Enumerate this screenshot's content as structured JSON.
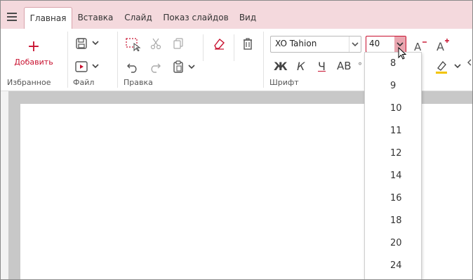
{
  "tabs": [
    "Главная",
    "Вставка",
    "Слайд",
    "Показ слайдов",
    "Вид"
  ],
  "ribbon": {
    "add_label": "Добавить",
    "groups": {
      "favorites": "Избранное",
      "file": "Файл",
      "edit": "Правка",
      "font": "Шрифт"
    },
    "font_name": "XO Tahion",
    "font_size": "40",
    "format_buttons": {
      "bold": "Ж",
      "italic": "К",
      "underline": "Ч",
      "caps": "АВ"
    },
    "decrease_font_icon": "A⁻",
    "increase_font_icon": "A⁺"
  },
  "dropdown": {
    "options": [
      "8",
      "9",
      "10",
      "11",
      "12",
      "14",
      "16",
      "18",
      "20",
      "24"
    ]
  },
  "colors": {
    "accent": "#c8102e",
    "tabbar": "#f4d9dd",
    "highlight": "#f2c400"
  }
}
